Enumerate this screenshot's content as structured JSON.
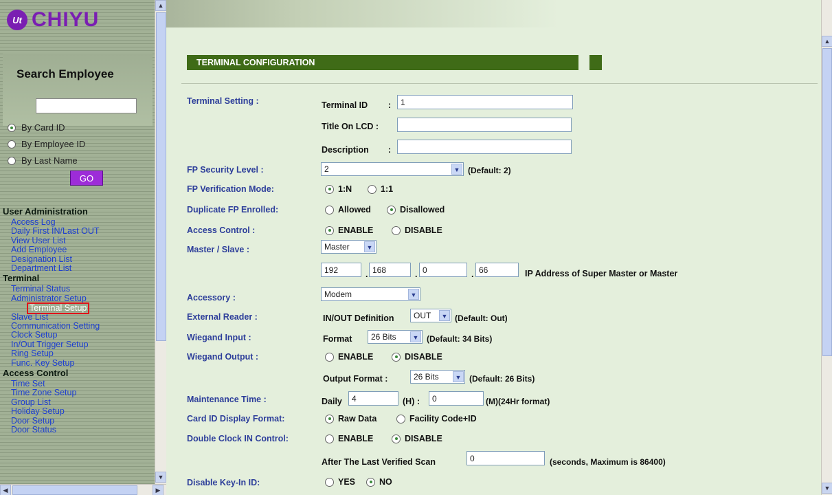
{
  "logo": {
    "mark": "Ut",
    "text": "CHIYU"
  },
  "search": {
    "title": "Search Employee",
    "value": "",
    "options": [
      {
        "label": "By Card ID",
        "selected": true
      },
      {
        "label": "By Employee ID",
        "selected": false
      },
      {
        "label": "By Last Name",
        "selected": false
      }
    ],
    "go": "GO"
  },
  "menu": {
    "user_admin": "User Administration",
    "ua_items": [
      "Access Log",
      "Daily First IN/Last OUT",
      "View User List",
      "Add Employee",
      "Designation List",
      "Department List"
    ],
    "terminal": "Terminal",
    "t_items": [
      "Terminal Status",
      "Administrator Setup",
      "Terminal Setup",
      "Slave List",
      "Communication Setting",
      "Clock Setup",
      "In/Out Trigger Setup",
      "Ring Setup",
      "Func. Key Setup"
    ],
    "access": "Access Control",
    "ac_items": [
      "Time Set",
      "Time Zone Setup",
      "Group List",
      "Holiday Setup",
      "Door Setup",
      "Door Status"
    ],
    "active_item": "Terminal Setup"
  },
  "page": {
    "title": "TERMINAL CONFIGURATION"
  },
  "form": {
    "terminal_setting": {
      "label": "Terminal Setting :",
      "id_label": "Terminal ID",
      ":": ":",
      "id_value": "1",
      "lcd_label": "Title On LCD :",
      "lcd_value": "",
      "desc_label": "Description",
      "desc_colon": ":",
      "desc_value": ""
    },
    "fp_security": {
      "label": "FP Security Level :",
      "value": "2",
      "note": "(Default: 2)"
    },
    "fp_verify": {
      "label": "FP Verification Mode:",
      "opt1": "1:N",
      "opt2": "1:1",
      "selected": "1:N"
    },
    "dup_fp": {
      "label": "Duplicate FP Enrolled:",
      "opt1": "Allowed",
      "opt2": "Disallowed",
      "selected": "Disallowed"
    },
    "access_control": {
      "label": "Access Control :",
      "opt1": "ENABLE",
      "opt2": "DISABLE",
      "selected": "ENABLE"
    },
    "master_slave": {
      "label": "Master / Slave :",
      "value": "Master",
      "ip": [
        "192",
        "168",
        "0",
        "66"
      ],
      "ip_note": "IP Address of Super Master or Master"
    },
    "accessory": {
      "label": "Accessory :",
      "value": "Modem"
    },
    "external_reader": {
      "label": "External Reader :",
      "def_label": "IN/OUT Definition",
      "value": "OUT",
      "note": "(Default: Out)"
    },
    "wiegand_input": {
      "label": "Wiegand Input :",
      "fmt_label": "Format",
      "value": "26 Bits",
      "note": "(Default: 34 Bits)"
    },
    "wiegand_output": {
      "label": "Wiegand Output :",
      "opt1": "ENABLE",
      "opt2": "DISABLE",
      "selected": "DISABLE",
      "fmt_label": "Output Format :",
      "value": "26 Bits",
      "note": "(Default: 26 Bits)"
    },
    "maintenance": {
      "label": "Maintenance Time :",
      "daily": "Daily",
      "h_value": "4",
      "h_label": "(H) :",
      "m_value": "0",
      "m_label": "(M)(24Hr format)"
    },
    "card_format": {
      "label": "Card ID Display Format:",
      "opt1": "Raw Data",
      "opt2": "Facility Code+ID",
      "selected": "Raw Data"
    },
    "double_clock": {
      "label": "Double Clock IN Control:",
      "opt1": "ENABLE",
      "opt2": "DISABLE",
      "selected": "DISABLE",
      "after_label": "After The Last Verified Scan",
      "after_value": "0",
      "after_note": "(seconds, Maximum is 86400)"
    },
    "disable_keyin": {
      "label": "Disable Key-In ID:",
      "opt1": "YES",
      "opt2": "NO",
      "selected": "NO"
    }
  },
  "colors": {
    "brand": "#7a1fb2",
    "header_bar": "#3f6b17",
    "label": "#2d3e9a",
    "link": "#1d3fd0",
    "active_outline": "#e0141a",
    "page_bg": "#e4efdc"
  }
}
